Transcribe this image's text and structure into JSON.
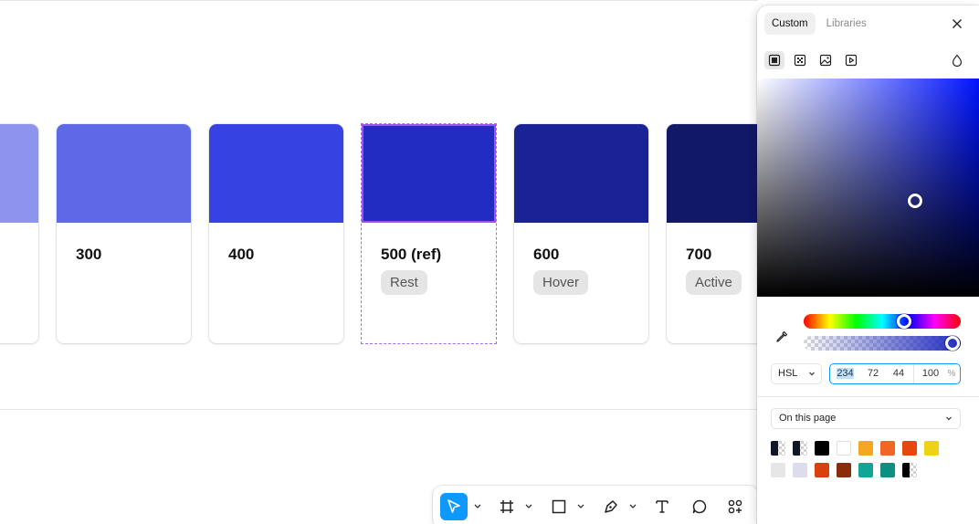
{
  "cards": [
    {
      "title": "",
      "pill": "",
      "color": "#8e93ee"
    },
    {
      "title": "300",
      "pill": "",
      "color": "#5f68e6"
    },
    {
      "title": "400",
      "pill": "",
      "color": "#3643e2"
    },
    {
      "title": "500 (ref)",
      "pill": "Rest",
      "color": "#222cc2"
    },
    {
      "title": "600",
      "pill": "Hover",
      "color": "#1a2396"
    },
    {
      "title": "700",
      "pill": "Active",
      "color": "#111865"
    }
  ],
  "toolbar": {
    "tools": [
      "move-icon",
      "frame-icon",
      "rectangle-icon",
      "pen-icon",
      "text-icon",
      "comment-icon",
      "actions-icon"
    ]
  },
  "panel": {
    "tabs": [
      {
        "label": "Custom",
        "active": true
      },
      {
        "label": "Libraries",
        "active": false
      }
    ],
    "paint_types": [
      "solid-paint-icon",
      "gradient-paint-icon",
      "image-paint-icon",
      "video-paint-icon"
    ],
    "color_model": "HSL",
    "hsl": {
      "h": "234",
      "s": "72",
      "l": "44",
      "a": "100",
      "unit": "%"
    },
    "hue_fraction": 0.65,
    "alpha_fraction": 1.0,
    "library_source": "On this page",
    "swatches": [
      {
        "color": "#101828",
        "kind": "split"
      },
      {
        "color": "#101828",
        "kind": "split"
      },
      {
        "color": "#000000",
        "kind": "solid"
      },
      {
        "color": "#ffffff",
        "kind": "solid"
      },
      {
        "color": "#f5a623",
        "kind": "solid"
      },
      {
        "color": "#f26522",
        "kind": "solid"
      },
      {
        "color": "#e8470c",
        "kind": "solid"
      },
      {
        "color": "#eed214",
        "kind": "solid"
      },
      {
        "color": "#e6e6e6",
        "kind": "solid"
      },
      {
        "color": "#dcdcec",
        "kind": "solid"
      },
      {
        "color": "#d8400e",
        "kind": "solid"
      },
      {
        "color": "#8a2b0c",
        "kind": "solid"
      },
      {
        "color": "#12a594",
        "kind": "solid"
      },
      {
        "color": "#0a8f80",
        "kind": "solid"
      },
      {
        "color": "#000000",
        "kind": "split"
      }
    ]
  }
}
